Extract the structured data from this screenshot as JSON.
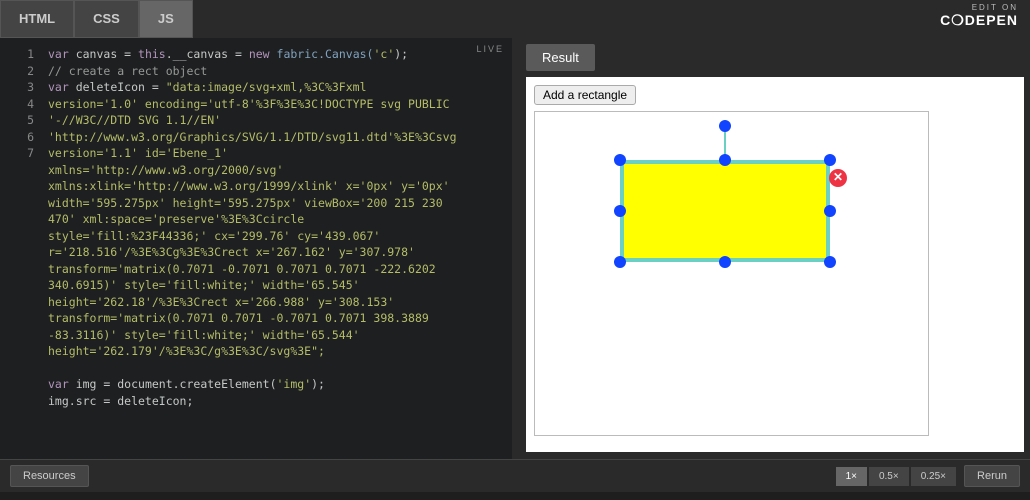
{
  "tabs": {
    "html": "HTML",
    "css": "CSS",
    "js": "JS"
  },
  "logo": {
    "edit": "EDIT ON",
    "main": "C❍DEPEN"
  },
  "live": "LIVE",
  "result_tab": "Result",
  "add_btn": "Add a rectangle",
  "footer": {
    "resources": "Resources",
    "rerun": "Rerun"
  },
  "zoom": {
    "z1": "1×",
    "z05": "0.5×",
    "z025": "0.25×"
  },
  "gutter": [
    "1",
    "2",
    "3",
    "",
    "",
    "",
    "",
    "",
    "",
    "",
    "",
    "",
    "",
    "",
    "",
    "",
    "",
    "",
    "4",
    "5",
    "6",
    "7"
  ],
  "code": {
    "l1_a": "var",
    "l1_b": " canvas = ",
    "l1_c": "this",
    "l1_d": ".__canvas = ",
    "l1_e": "new",
    "l1_f": " fabric.Canvas(",
    "l1_g": "'c'",
    "l1_h": ");",
    "l2": "// create a rect object",
    "l3_a": "var",
    "l3_b": " deleteIcon = ",
    "l3_c": "\"data:image/svg+xml,%3C%3Fxml",
    "l4": "version='1.0' encoding='utf-8'%3F%3E%3C!DOCTYPE svg PUBLIC",
    "l5": "'-//W3C//DTD SVG 1.1//EN'",
    "l6": "'http://www.w3.org/Graphics/SVG/1.1/DTD/svg11.dtd'%3E%3Csvg",
    "l7": "version='1.1' id='Ebene_1'",
    "l8": "xmlns='http://www.w3.org/2000/svg'",
    "l9": "xmlns:xlink='http://www.w3.org/1999/xlink' x='0px' y='0px'",
    "l10": "width='595.275px' height='595.275px' viewBox='200 215 230",
    "l11": "470' xml:space='preserve'%3E%3Ccircle",
    "l12": "style='fill:%23F44336;' cx='299.76' cy='439.067'",
    "l13": "r='218.516'/%3E%3Cg%3E%3Crect x='267.162' y='307.978'",
    "l14": "transform='matrix(0.7071 -0.7071 0.7071 0.7071 -222.6202",
    "l15": "340.6915)' style='fill:white;' width='65.545'",
    "l16": "height='262.18'/%3E%3Crect x='266.988' y='308.153'",
    "l17": "transform='matrix(0.7071 0.7071 -0.7071 0.7071 398.3889",
    "l18": "-83.3116)' style='fill:white;' width='65.544'",
    "l19": "height='262.179'/%3E%3C/g%3E%3C/svg%3E\";",
    "l20_a": "var",
    "l20_b": " img = document.createElement(",
    "l20_c": "'img'",
    "l20_d": ");",
    "l21": "img.src = deleteIcon;"
  },
  "canvas": {
    "rect_fill": "#ffff00",
    "rect_stroke": "#6bcfc2",
    "handle_color": "#1144ff",
    "delete_color": "#ee3344"
  }
}
